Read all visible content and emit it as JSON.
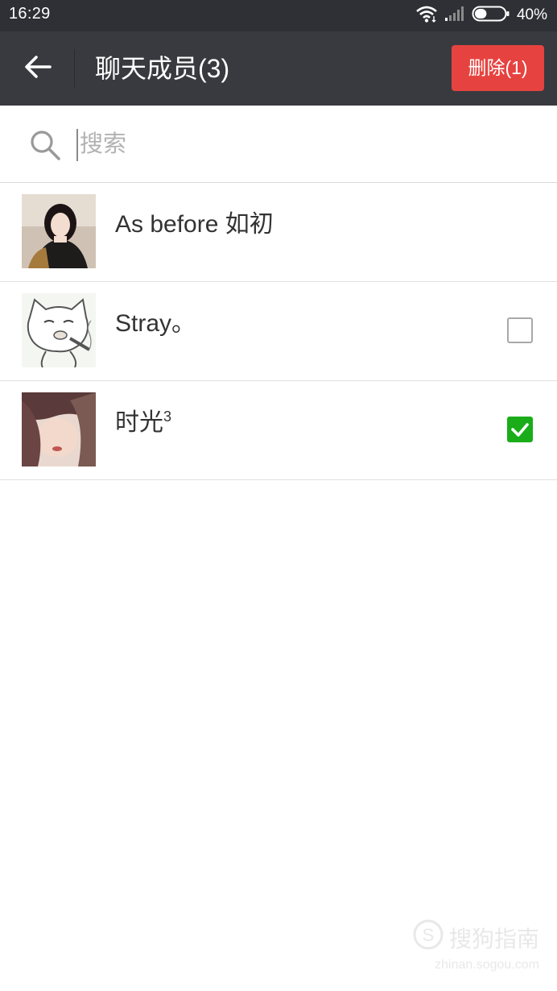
{
  "status_bar": {
    "time": "16:29",
    "battery_percent": "40%",
    "battery_level": 0.4
  },
  "header": {
    "title": "聊天成员(3)",
    "delete_button_label": "删除(1)",
    "delete_button_color": "#e64340",
    "bar_color": "#393a3f"
  },
  "search": {
    "placeholder": "搜索",
    "value": ""
  },
  "members": [
    {
      "name": "As before 如初",
      "selectable": false,
      "selected": false
    },
    {
      "name": "Stray。",
      "selectable": true,
      "selected": false
    },
    {
      "name": "时光",
      "name_superscript": "3",
      "selectable": true,
      "selected": true
    }
  ],
  "watermark": {
    "brand": "搜狗指南",
    "url": "zhinan.sogou.com"
  },
  "colors": {
    "check_green": "#1aad19"
  }
}
